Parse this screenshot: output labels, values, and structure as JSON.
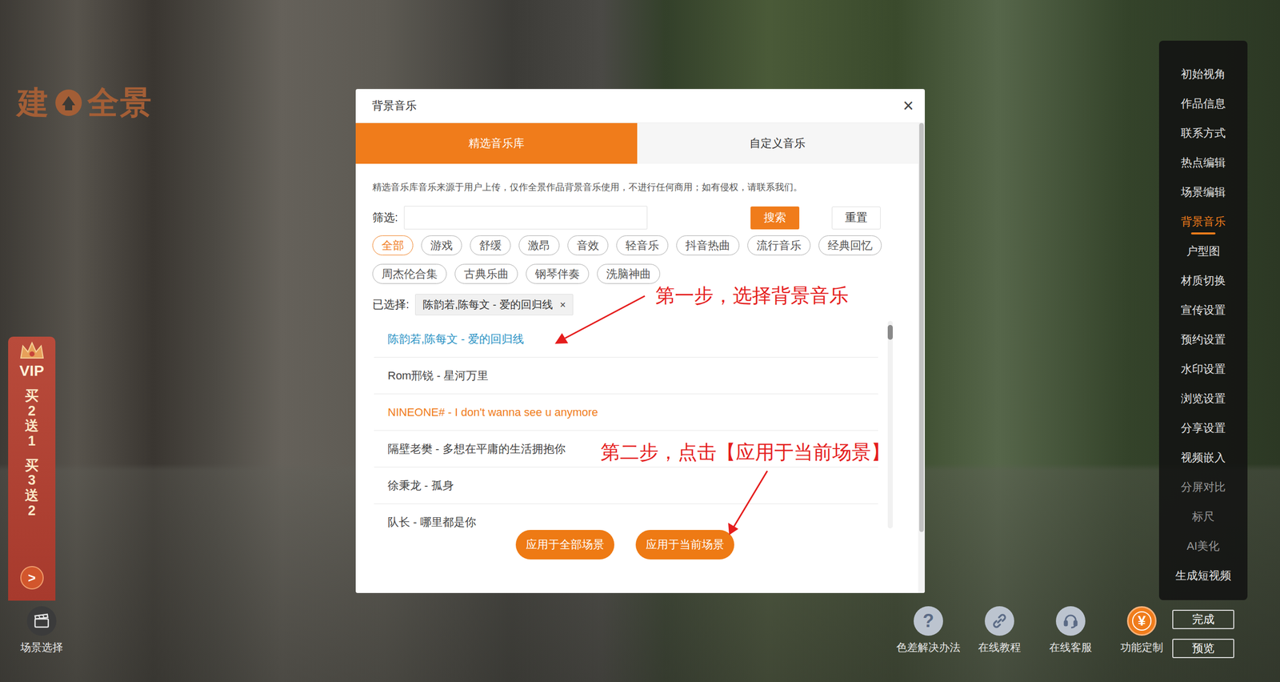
{
  "logo": {
    "left": "建",
    "right": "全景"
  },
  "vip_banner": {
    "badge": "VIP",
    "offers": [
      "买2送1",
      "买3送2"
    ],
    "arrow": ">"
  },
  "sidebar": {
    "items": [
      {
        "label": "初始视角",
        "selected": false,
        "disabled": false
      },
      {
        "label": "作品信息",
        "selected": false,
        "disabled": false
      },
      {
        "label": "联系方式",
        "selected": false,
        "disabled": false
      },
      {
        "label": "热点编辑",
        "selected": false,
        "disabled": false
      },
      {
        "label": "场景编辑",
        "selected": false,
        "disabled": false
      },
      {
        "label": "背景音乐",
        "selected": true,
        "disabled": false
      },
      {
        "label": "户型图",
        "selected": false,
        "disabled": false
      },
      {
        "label": "材质切换",
        "selected": false,
        "disabled": false
      },
      {
        "label": "宣传设置",
        "selected": false,
        "disabled": false
      },
      {
        "label": "预约设置",
        "selected": false,
        "disabled": false
      },
      {
        "label": "水印设置",
        "selected": false,
        "disabled": false
      },
      {
        "label": "浏览设置",
        "selected": false,
        "disabled": false
      },
      {
        "label": "分享设置",
        "selected": false,
        "disabled": false
      },
      {
        "label": "视频嵌入",
        "selected": false,
        "disabled": false
      },
      {
        "label": "分屏对比",
        "selected": false,
        "disabled": true
      },
      {
        "label": "标尺",
        "selected": false,
        "disabled": true
      },
      {
        "label": "AI美化",
        "selected": false,
        "disabled": true
      },
      {
        "label": "生成短视频",
        "selected": false,
        "disabled": false
      }
    ]
  },
  "scene_select": {
    "label": "场景选择"
  },
  "toolbar": {
    "items": [
      {
        "label": "色差解决办法",
        "kind": "help",
        "glyph": "?"
      },
      {
        "label": "在线教程",
        "kind": "link"
      },
      {
        "label": "在线客服",
        "kind": "support"
      },
      {
        "label": "功能定制",
        "kind": "custom",
        "glyph": "¥"
      }
    ]
  },
  "actions": [
    "完成",
    "预览"
  ],
  "dialog": {
    "title": "背景音乐",
    "close": "×",
    "tabs": [
      {
        "label": "精选音乐库",
        "selected": true
      },
      {
        "label": "自定义音乐",
        "selected": false
      }
    ],
    "notice": "精选音乐库音乐来源于用户上传，仅作全景作品背景音乐使用，不进行任何商用；如有侵权，请联系我们。",
    "filter": {
      "label": "筛选:",
      "search": "搜索",
      "reset": "重置"
    },
    "categories": [
      {
        "label": "全部",
        "selected": true
      },
      {
        "label": "游戏",
        "selected": false
      },
      {
        "label": "舒缓",
        "selected": false
      },
      {
        "label": "激昂",
        "selected": false
      },
      {
        "label": "音效",
        "selected": false
      },
      {
        "label": "轻音乐",
        "selected": false
      },
      {
        "label": "抖音热曲",
        "selected": false
      },
      {
        "label": "流行音乐",
        "selected": false
      },
      {
        "label": "经典回忆",
        "selected": false
      },
      {
        "label": "周杰伦合集",
        "selected": false
      },
      {
        "label": "古典乐曲",
        "selected": false
      },
      {
        "label": "钢琴伴奏",
        "selected": false
      },
      {
        "label": "洗脑神曲",
        "selected": false
      }
    ],
    "selected_label": "已选择:",
    "selected_chips": [
      {
        "label": "陈韵若,陈每文 - 爱的回归线",
        "remove": "×"
      }
    ],
    "songs": [
      {
        "title": "陈韵若,陈每文 - 爱的回归线",
        "selected": true,
        "hovered": false
      },
      {
        "title": "Rom邢锐 - 星河万里",
        "selected": false,
        "hovered": false
      },
      {
        "title": "NINEONE# - I don't wanna see u anymore",
        "selected": false,
        "hovered": true
      },
      {
        "title": "隔壁老樊 - 多想在平庸的生活拥抱你",
        "selected": false,
        "hovered": false
      },
      {
        "title": "徐秉龙 - 孤身",
        "selected": false,
        "hovered": false
      },
      {
        "title": "队长 - 哪里都是你",
        "selected": false,
        "hovered": false
      }
    ],
    "list_scrollbar": {
      "level": 0.07
    },
    "scrollbar": {
      "level": 0.87
    },
    "buttons": [
      "应用于全部场景",
      "应用于当前场景"
    ]
  },
  "annotations": [
    {
      "text": "第一步，选择背景音乐"
    },
    {
      "text": "第二步，点击【应用于当前场景】"
    }
  ]
}
